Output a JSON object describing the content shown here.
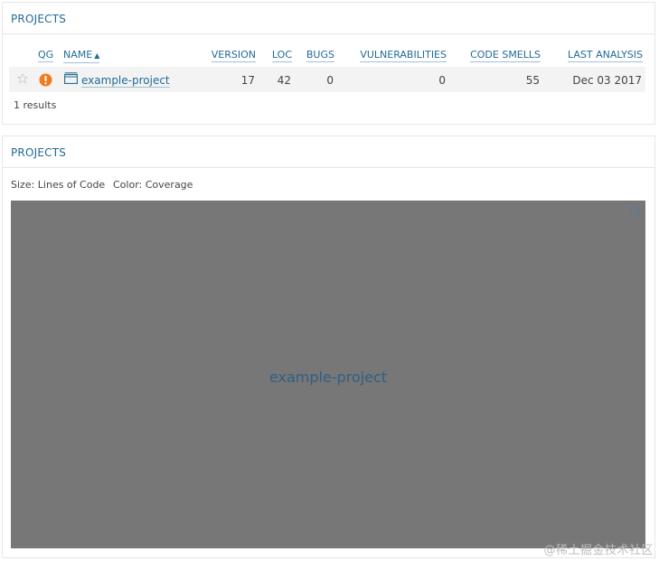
{
  "panel_top": {
    "title": "PROJECTS",
    "columns": {
      "qg": "QG",
      "name": "NAME",
      "version": "VERSION",
      "loc": "LOC",
      "bugs": "BUGS",
      "vulnerabilities": "VULNERABILITIES",
      "code_smells": "CODE SMELLS",
      "last_analysis": "LAST ANALYSIS"
    },
    "sort_indicator": "▲",
    "rows": [
      {
        "name": "example-project",
        "version": "17",
        "loc": "42",
        "bugs": "0",
        "vulnerabilities": "0",
        "code_smells": "55",
        "last_analysis": "Dec 03 2017",
        "quality_gate": "warning"
      }
    ],
    "results_text": "1 results"
  },
  "panel_bottom": {
    "title": "PROJECTS",
    "size_label": "Size: Lines of Code",
    "color_label": "Color: Coverage",
    "treemap": {
      "project_label": "example-project",
      "fill_color": "#777777"
    }
  },
  "icons": {
    "favorite": "star-icon",
    "quality_gate": "warning-icon",
    "project": "folder-icon",
    "zoom": "zoom-icon"
  },
  "colors": {
    "accent": "#236a97",
    "warning": "#ed7d20",
    "row_bg": "#f3f3f3"
  },
  "watermark": "@稀土掘金技术社区"
}
